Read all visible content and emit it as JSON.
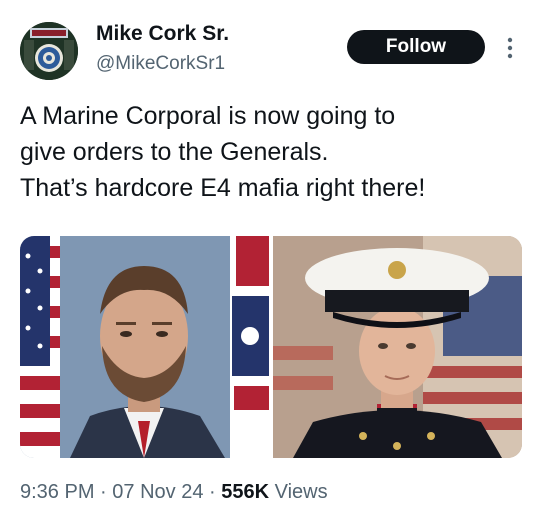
{
  "author": {
    "display_name": "Mike Cork Sr.",
    "handle": "@MikeCorkSr1",
    "avatar_icon": "veteran-badge-avatar"
  },
  "follow_button": {
    "label": "Follow"
  },
  "more_menu": {
    "icon": "more-vertical-icon"
  },
  "tweet": {
    "lines": [
      "A Marine Corporal is now going to",
      "give orders to the Generals.",
      "That’s hardcore E4 mafia right there!"
    ]
  },
  "media": {
    "photos": [
      {
        "name": "portrait-man-suit-flags"
      },
      {
        "name": "portrait-marine-dress-blues"
      }
    ]
  },
  "meta": {
    "time": "9:36 PM",
    "separator": "·",
    "date": "07 Nov 24",
    "views_count": "556K",
    "views_label": "Views"
  },
  "colors": {
    "text_primary": "#0f1419",
    "text_secondary": "#536471",
    "button_bg": "#0f1419",
    "button_text": "#ffffff"
  }
}
